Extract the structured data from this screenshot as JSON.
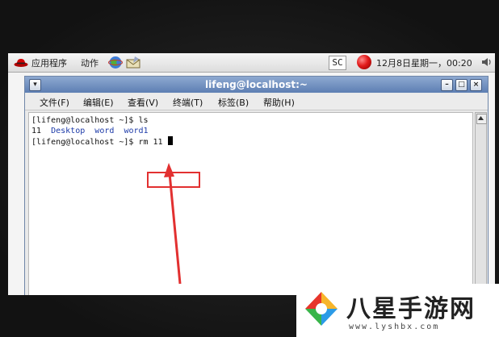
{
  "panel": {
    "apps_label": "应用程序",
    "actions_label": "动作",
    "ime_label": "SC",
    "datetime": "12月8日星期一，00:20"
  },
  "window": {
    "title": "lifeng@localhost:~",
    "menus": [
      "文件(F)",
      "编辑(E)",
      "查看(V)",
      "终端(T)",
      "标签(B)",
      "帮助(H)"
    ]
  },
  "terminal": {
    "line1_prompt": "[lifeng@localhost ~]$ ",
    "line1_cmd": "ls",
    "line2_files": [
      "11",
      "Desktop",
      "word",
      "word1"
    ],
    "line3_prompt": "[lifeng@localhost ~]$ ",
    "line3_cmd": "rm 11"
  },
  "watermark": {
    "name": "八星手游网",
    "url": "www.lyshbx.com"
  },
  "colors": {
    "annotation": "#e23030",
    "titlebar": "#6f8fc0",
    "file_blue": "#1c3aa8"
  }
}
